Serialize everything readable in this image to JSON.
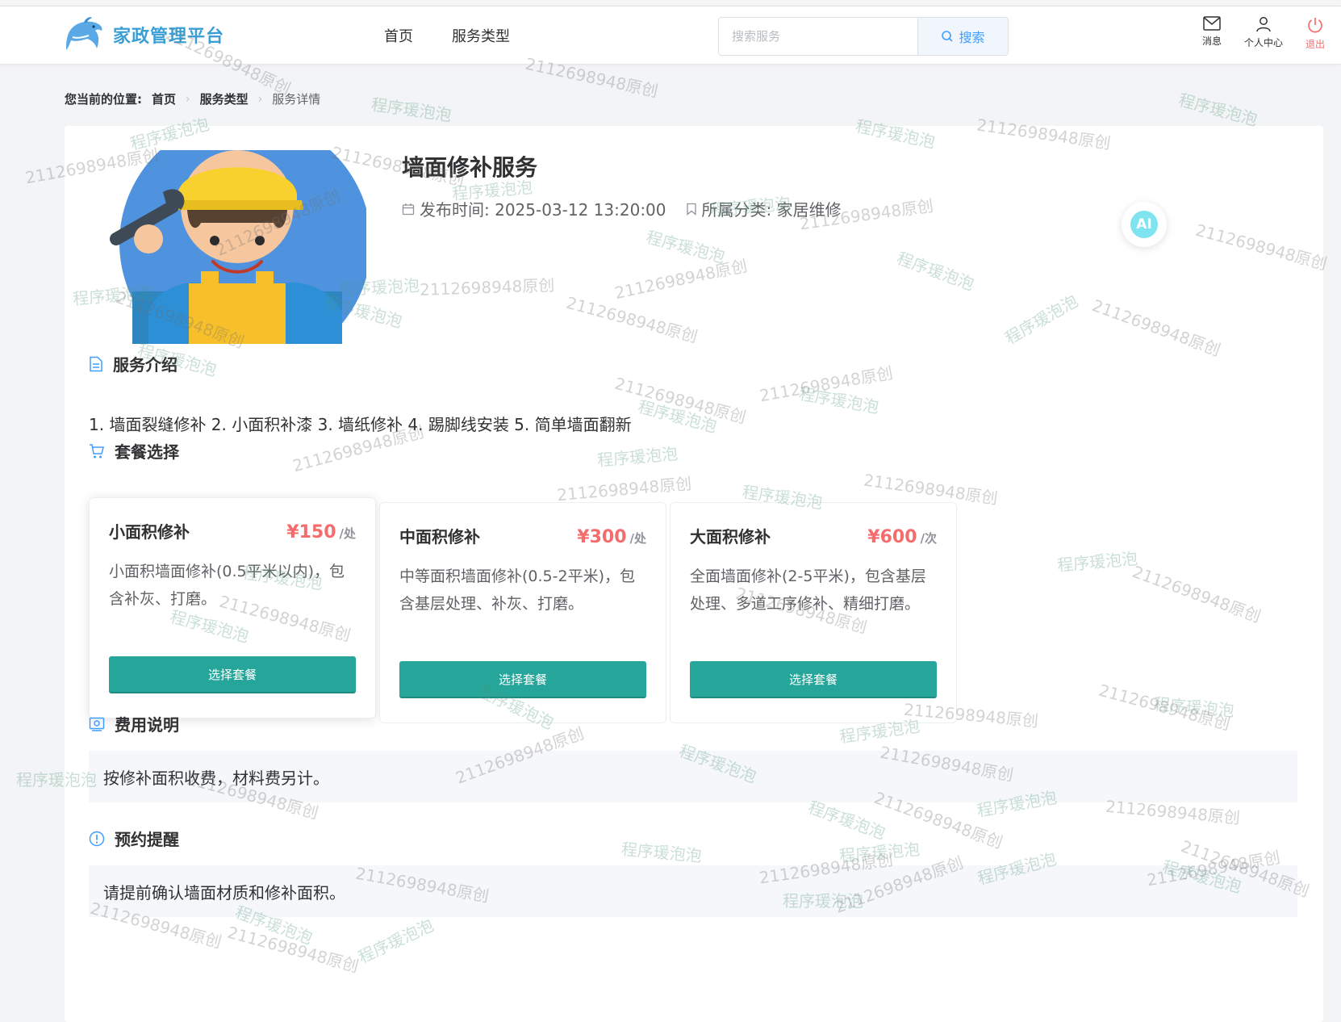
{
  "header": {
    "logo_text": "家政管理平台",
    "nav": [
      "首页",
      "服务类型"
    ],
    "search_placeholder": "搜索服务",
    "search_button": "搜索",
    "actions": {
      "messages": "消息",
      "profile": "个人中心",
      "logout": "退出"
    }
  },
  "breadcrumb": {
    "lead": "您当前的位置:",
    "items": [
      "首页",
      "服务类型"
    ],
    "current": "服务详情"
  },
  "service": {
    "title": "墙面修补服务",
    "publish_time": "发布时间: 2025-03-12 13:20:00",
    "category": "所属分类: 家居维修",
    "ai_label": "AI"
  },
  "intro": {
    "title": "服务介绍",
    "text": "1. 墙面裂缝修补 2. 小面积补漆 3. 墙纸修补 4. 踢脚线安装 5. 简单墙面翻新"
  },
  "packages": {
    "title": "套餐选择",
    "button_label": "选择套餐",
    "items": [
      {
        "name": "小面积修补",
        "price": "¥150",
        "unit": "/处",
        "desc": "小面积墙面修补(0.5平米以内)，包含补灰、打磨。"
      },
      {
        "name": "中面积修补",
        "price": "¥300",
        "unit": "/处",
        "desc": "中等面积墙面修补(0.5-2平米)，包含基层处理、补灰、打磨。"
      },
      {
        "name": "大面积修补",
        "price": "¥600",
        "unit": "/次",
        "desc": "全面墙面修补(2-5平米)，包含基层处理、多道工序修补、精细打磨。"
      }
    ]
  },
  "fee": {
    "title": "费用说明",
    "text": "按修补面积收费，材料费另计。"
  },
  "reminder": {
    "title": "预约提醒",
    "text": "请提前确认墙面材质和修补面积。"
  },
  "watermark": {
    "texts": [
      "2112698948原创",
      "程序瑗泡泡"
    ]
  },
  "colors": {
    "brand": "#3b9fd6",
    "primary_button": "#26a69a",
    "price": "#f56c6c",
    "link": "#409eff",
    "logout": "#f56c6c"
  }
}
